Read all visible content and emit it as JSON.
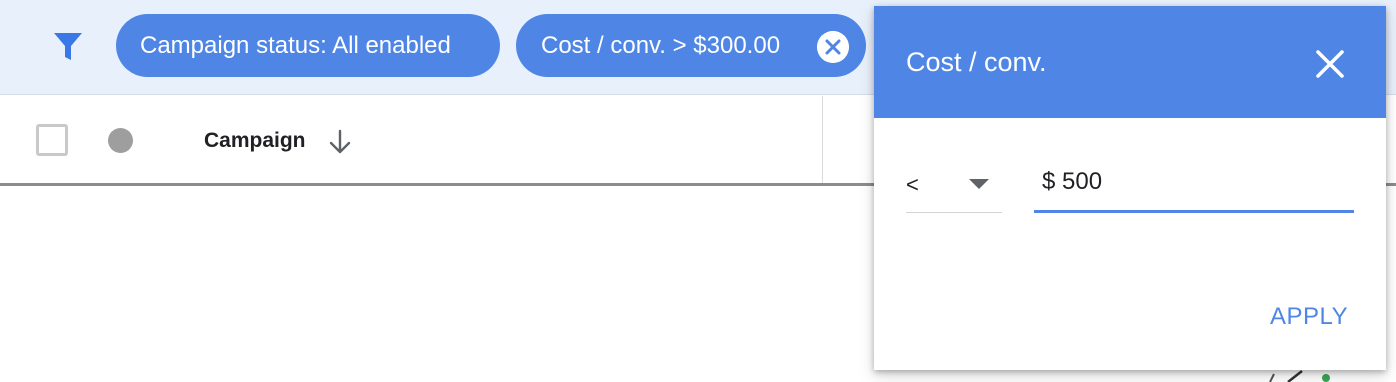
{
  "filter_bar": {
    "chips": [
      {
        "label": "Campaign status: All enabled"
      },
      {
        "label": "Cost / conv. > $300.00"
      }
    ]
  },
  "table": {
    "columns": {
      "campaign": "Campaign"
    }
  },
  "popover": {
    "title": "Cost / conv.",
    "operator": "<",
    "value": "$ 500",
    "apply_label": "APPLY"
  },
  "colors": {
    "accent": "#4f86e6",
    "filter_bar_bg": "#e8f0fb"
  },
  "icons": {
    "filter": "funnel-icon",
    "chip_remove": "close-circle-icon",
    "sort": "arrow-down-icon",
    "close": "close-icon",
    "dropdown": "caret-down-icon"
  }
}
